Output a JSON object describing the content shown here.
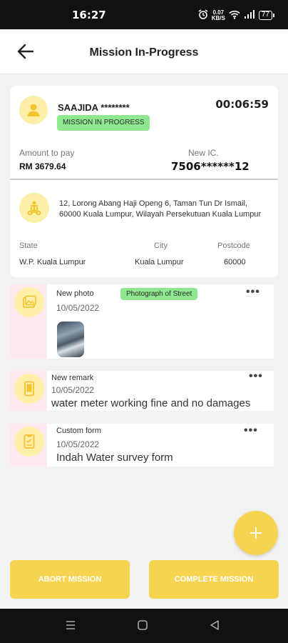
{
  "status_bar": {
    "time": "16:27",
    "network_speed": "0.07",
    "network_unit": "KB/S",
    "battery": "77",
    "icons": [
      "alarm-icon",
      "wifi-icon",
      "signal-icon",
      "battery-icon"
    ]
  },
  "header": {
    "title": "Mission In-Progress"
  },
  "mission": {
    "name": "SAAJIDA ********",
    "timer": "00:06:59",
    "status": "MISSION IN PROGRESS",
    "amount_label": "Amount to pay",
    "amount_value": "RM 3679.64",
    "ic_label": "New IC.",
    "ic_value": "7506******12",
    "address": "12, Lorong Abang Haji Openg 6, Taman Tun Dr Ismail, 60000 Kuala Lumpur, Wilayah Persekutuan Kuala Lumpur",
    "state_label": "State",
    "state_value": "W.P. Kuala Lumpur",
    "city_label": "City",
    "city_value": "Kuala Lumpur",
    "postcode_label": "Postcode",
    "postcode_value": "60000"
  },
  "activities": [
    {
      "type": "New photo",
      "tag": "Photograph of Street",
      "date": "10/05/2022",
      "icon": "gallery-icon"
    },
    {
      "type": "New remark",
      "date": "10/05/2022",
      "text": "water meter working fine and no damages",
      "icon": "phone-icon"
    },
    {
      "type": "Custom form",
      "date": "10/05/2022",
      "text": "Indah Water survey form",
      "icon": "form-icon"
    }
  ],
  "more_label": "•••",
  "fab_label": "+",
  "buttons": {
    "abort": "ABORT MISSION",
    "complete": "COMPLETE MISSION"
  },
  "colors": {
    "accent": "#f6d452",
    "badge_green": "#8fe88f",
    "icon_bg": "#fdeea8",
    "strip_pink": "#fbe9ee"
  }
}
